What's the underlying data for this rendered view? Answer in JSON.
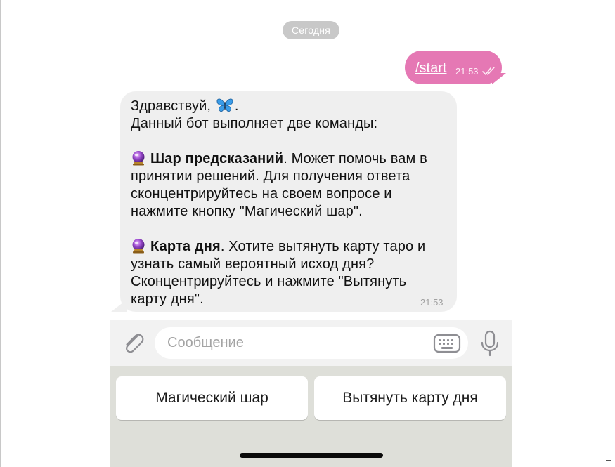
{
  "chat": {
    "date_separator": "Сегодня",
    "outgoing": {
      "text": "/start",
      "time": "21:53",
      "status_icon": "double-check-icon",
      "bubble_color": "#e578b4"
    },
    "incoming": {
      "lines": {
        "greeting": "Здравствуй,",
        "greeting_end": ".",
        "intro": "Данный бот выполняет две команды:",
        "ball_title": "Шар предсказаний",
        "ball_line1_rest": ". Может помочь вам в",
        "ball_line2": "принятии решений. Для получения ответа",
        "ball_line3": "сконцентрируйтесь на своем вопросе и",
        "ball_line4": "нажмите кнопку \"Магический шар\".",
        "card_title": "Карта дня",
        "card_line1_rest": ". Хотите вытянуть карту таро и",
        "card_line2": "узнать самый вероятный исход дня?",
        "card_line3": "Сконцентрируйтесь и нажмите \"Вытянуть",
        "card_line4": "карту дня\"."
      },
      "emoji": [
        "butterfly-emoji",
        "crystal-ball-emoji"
      ],
      "time": "21:53",
      "bubble_color": "#efefef"
    }
  },
  "composer": {
    "placeholder": "Сообщение",
    "icons": [
      "paperclip-icon",
      "keyboard-icon",
      "microphone-icon"
    ]
  },
  "reply_keyboard": {
    "buttons": [
      "Магический шар",
      "Вытянуть карту дня"
    ]
  }
}
